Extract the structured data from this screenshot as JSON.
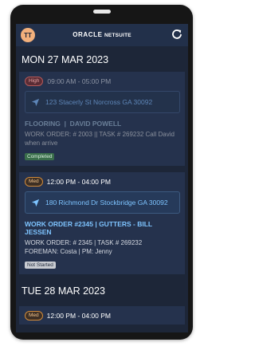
{
  "app": {
    "avatar_initials": "TT",
    "brand_oracle": "ORACLE",
    "brand_netsuite": "NETSUITE"
  },
  "days": [
    {
      "date": "MON 27 MAR 2023",
      "jobs": [
        {
          "priority": "High",
          "time": "09:00 AM - 05:00 PM",
          "address": "123 Stacerly St Norcross GA 30092",
          "title": "FLOORING  |  DAVID POWELL",
          "detail": "WORK ORDER: # 2003 || TASK # 269232 Call David when arrive",
          "status": "Completed"
        },
        {
          "priority": "Med",
          "time": "12:00 PM - 04:00 PM",
          "address": "180 Richmond Dr Stockbridge GA 30092",
          "title": "WORK ORDER #2345 | GUTTERS - BILL JESSEN",
          "detail_line1": "WORK ORDER: # 2345 | TASK # 269232",
          "detail_line2": "FOREMAN: Costa | PM: Jenny",
          "status": "Not Started"
        }
      ]
    },
    {
      "date": "TUE 28 MAR 2023",
      "jobs": [
        {
          "priority": "Med",
          "time": "12:00 PM - 04:00 PM"
        }
      ]
    }
  ],
  "colors": {
    "background": "#1d2638",
    "appbar": "#22304a",
    "card": "#25324d",
    "accent_blue": "#7ec4ff",
    "high": "#b55a5a",
    "med": "#d18a3a",
    "completed": "#3a6e4b"
  },
  "icons": {
    "refresh": "refresh-icon",
    "navigate": "navigation-arrow-icon"
  }
}
